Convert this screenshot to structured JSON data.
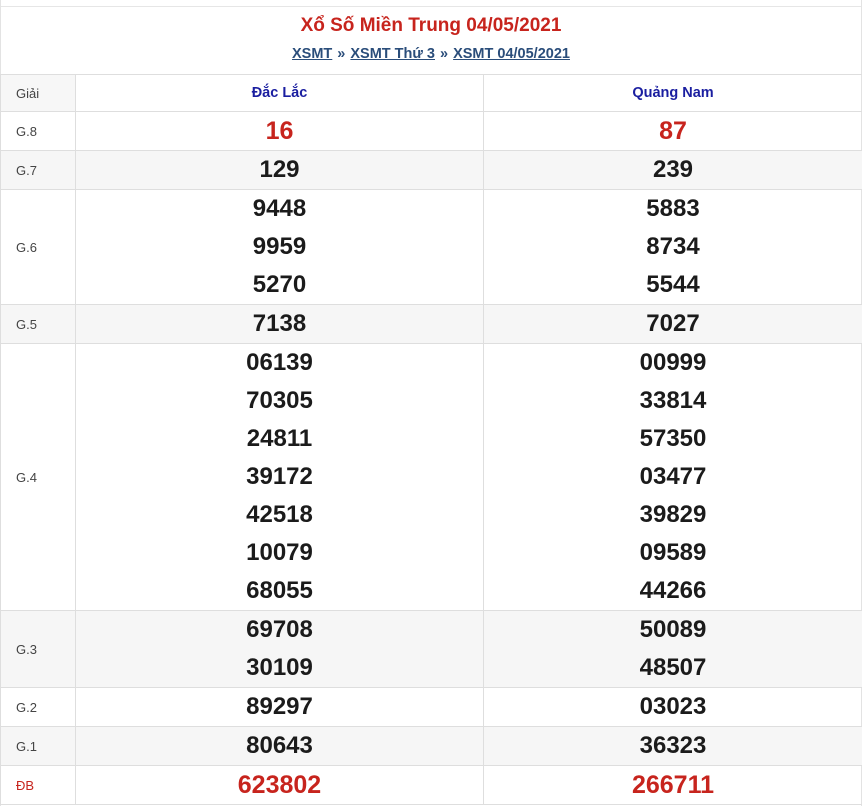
{
  "title": "Xổ Số Miền Trung 04/05/2021",
  "breadcrumb": [
    {
      "label": "XSMT"
    },
    {
      "label": "XSMT Thứ 3"
    },
    {
      "label": "XSMT 04/05/2021"
    }
  ],
  "separator": "»",
  "table": {
    "header": {
      "giai": "Giải",
      "col1": "Đắc Lắc",
      "col2": "Quảng Nam"
    },
    "rows": [
      {
        "label": "G.8",
        "col1": [
          "16"
        ],
        "col2": [
          "87"
        ]
      },
      {
        "label": "G.7",
        "col1": [
          "129"
        ],
        "col2": [
          "239"
        ]
      },
      {
        "label": "G.6",
        "col1": [
          "9448",
          "9959",
          "5270"
        ],
        "col2": [
          "5883",
          "8734",
          "5544"
        ]
      },
      {
        "label": "G.5",
        "col1": [
          "7138"
        ],
        "col2": [
          "7027"
        ]
      },
      {
        "label": "G.4",
        "col1": [
          "06139",
          "70305",
          "24811",
          "39172",
          "42518",
          "10079",
          "68055"
        ],
        "col2": [
          "00999",
          "33814",
          "57350",
          "03477",
          "39829",
          "09589",
          "44266"
        ]
      },
      {
        "label": "G.3",
        "col1": [
          "69708",
          "30109"
        ],
        "col2": [
          "50089",
          "48507"
        ]
      },
      {
        "label": "G.2",
        "col1": [
          "89297"
        ],
        "col2": [
          "03023"
        ]
      },
      {
        "label": "G.1",
        "col1": [
          "80643"
        ],
        "col2": [
          "36323"
        ]
      },
      {
        "label": "ĐB",
        "col1": [
          "623802"
        ],
        "col2": [
          "266711"
        ]
      }
    ]
  },
  "colors": {
    "title": "#c7241d",
    "province": "#1a1ea0",
    "link": "#2a4d7a",
    "special": "#c7241d"
  }
}
